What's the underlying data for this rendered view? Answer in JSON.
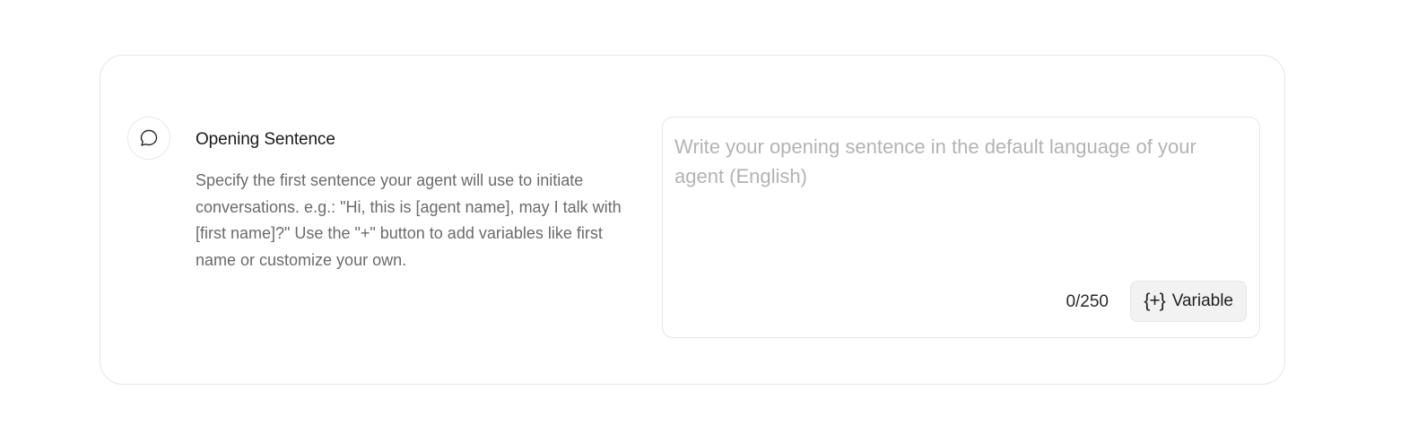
{
  "section": {
    "icon": "chat-bubble-icon",
    "title": "Opening Sentence",
    "description": "Specify the first sentence your agent will use to initiate conversations. e.g.: \"Hi, this is [agent name], may I talk with [first name]?\" Use the \"+\" button to add variables like first name or customize your own."
  },
  "editor": {
    "value": "",
    "placeholder": "Write your opening sentence in the default language of your agent (English)",
    "counter": "0/250",
    "variable_button": {
      "icon": "braces-plus-icon",
      "icon_glyph": "{+}",
      "label": "Variable"
    }
  },
  "colors": {
    "border": "#e5e5e5",
    "title": "#1a1a1a",
    "description": "#6b6b6b",
    "placeholder": "#b3b3b3",
    "button_bg": "#f2f2f2"
  }
}
